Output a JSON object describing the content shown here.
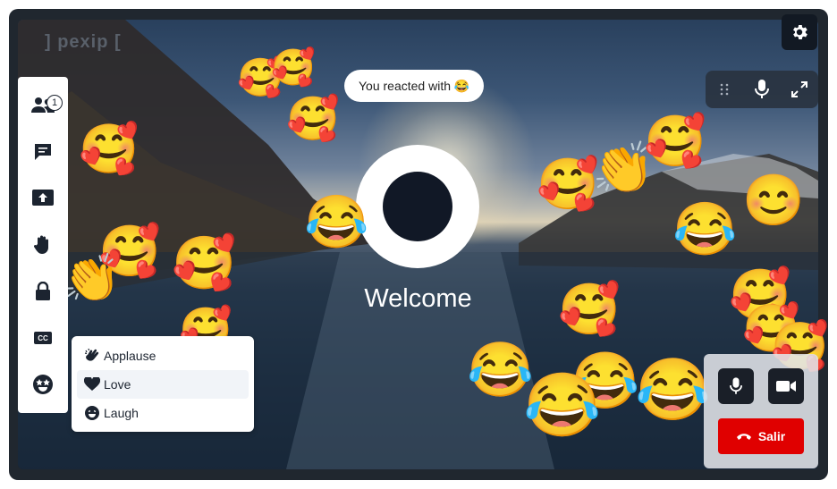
{
  "logo": {
    "text": "] pexip ["
  },
  "toast": {
    "text": "You reacted with 😂"
  },
  "stage": {
    "welcome": "Welcome"
  },
  "sidebar": {
    "participants_badge": "1",
    "items": [
      {
        "name": "participants",
        "icon": "participants-icon"
      },
      {
        "name": "chat",
        "icon": "chat-icon"
      },
      {
        "name": "share",
        "icon": "share-screen-icon"
      },
      {
        "name": "raise-hand",
        "icon": "raise-hand-icon"
      },
      {
        "name": "lock",
        "icon": "lock-icon"
      },
      {
        "name": "captions",
        "icon": "captions-icon",
        "label": "CC"
      },
      {
        "name": "reactions",
        "icon": "star-eyes-icon"
      }
    ]
  },
  "reactions_menu": {
    "items": [
      {
        "label": "Applause",
        "icon": "applause-icon"
      },
      {
        "label": "Love",
        "icon": "heart-icon",
        "selected": true
      },
      {
        "label": "Laugh",
        "icon": "laugh-icon"
      }
    ]
  },
  "top_controls": {
    "icons": [
      "drag-handle-icon",
      "microphone-icon",
      "fullscreen-icon"
    ]
  },
  "selfview": {
    "leave_label": "Salir",
    "icons": [
      "microphone-icon",
      "camera-icon",
      "hangup-icon"
    ]
  },
  "floating_emojis": {
    "love": "🥰",
    "laugh": "😂",
    "applause": "👏",
    "joy": "😊"
  },
  "colors": {
    "leave": "#e00000",
    "panel": "#ffffff",
    "dark_button": "#1a1f28"
  }
}
